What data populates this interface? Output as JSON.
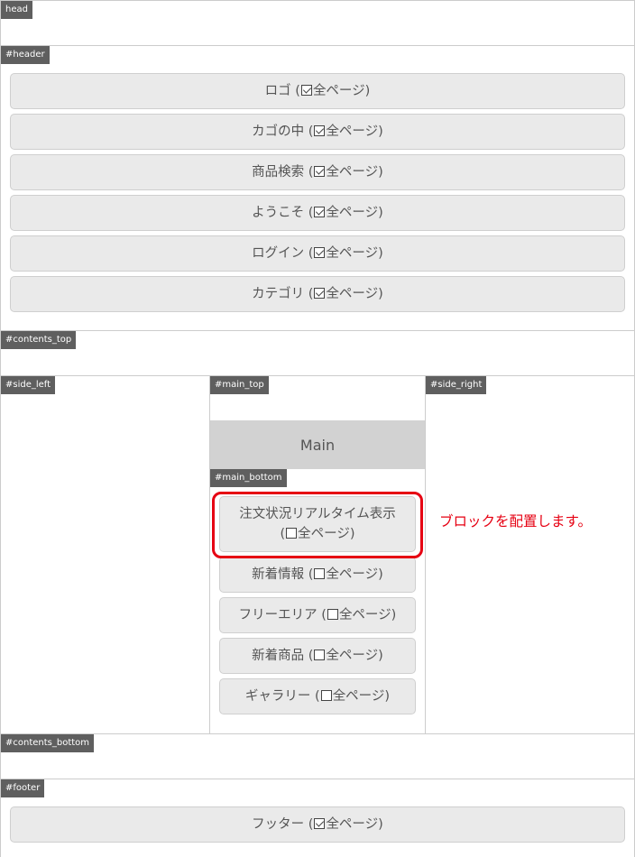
{
  "areas": {
    "head": "head",
    "header": "#header",
    "contents_top": "#contents_top",
    "side_left": "#side_left",
    "main_top": "#main_top",
    "side_right": "#side_right",
    "main_bottom": "#main_bottom",
    "contents_bottom": "#contents_bottom",
    "footer": "#footer"
  },
  "all_pages_label": "全ページ",
  "header_blocks": [
    {
      "name": "ロゴ",
      "all_pages": true
    },
    {
      "name": "カゴの中",
      "all_pages": true
    },
    {
      "name": "商品検索",
      "all_pages": true
    },
    {
      "name": "ようこそ",
      "all_pages": true
    },
    {
      "name": "ログイン",
      "all_pages": true
    },
    {
      "name": "カテゴリ",
      "all_pages": true
    }
  ],
  "main_label": "Main",
  "main_bottom_blocks": [
    {
      "name": "注文状況リアルタイム表示",
      "all_pages": false,
      "highlighted": true
    },
    {
      "name": "新着情報",
      "all_pages": false
    },
    {
      "name": "フリーエリア",
      "all_pages": false
    },
    {
      "name": "新着商品",
      "all_pages": false
    },
    {
      "name": "ギャラリー",
      "all_pages": false
    }
  ],
  "footer_blocks": [
    {
      "name": "フッター",
      "all_pages": true
    }
  ],
  "annotation": {
    "text": "ブロックを配置します。",
    "color": "#e60012"
  }
}
